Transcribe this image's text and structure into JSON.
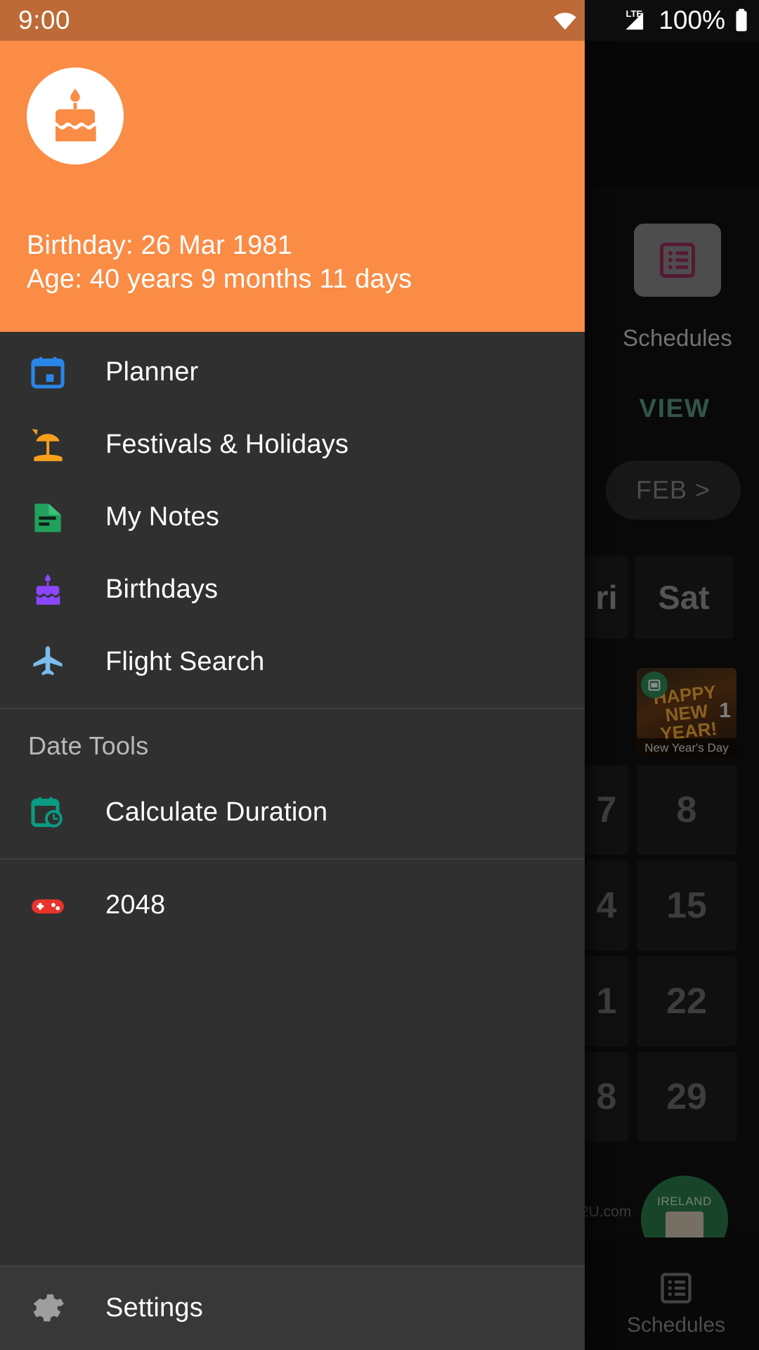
{
  "status_bar": {
    "time": "9:00",
    "wifi_icon": "wifi-icon",
    "network_label": "LTE",
    "battery_percent": "100%",
    "battery_icon": "battery-full-icon"
  },
  "drawer": {
    "header": {
      "avatar_icon": "birthday-cake-icon",
      "birthday_line": "Birthday: 26 Mar 1981",
      "age_line": "Age: 40 years 9 months 11 days",
      "background_color": "#fa8c46"
    },
    "primary_items": [
      {
        "label": "Planner",
        "icon": "calendar-icon",
        "color": "#2a86e8"
      },
      {
        "label": "Festivals & Holidays",
        "icon": "beach-umbrella-icon",
        "color": "#f9a01b"
      },
      {
        "label": "My Notes",
        "icon": "note-document-icon",
        "color": "#22a05c"
      },
      {
        "label": "Birthdays",
        "icon": "birthday-cake-icon",
        "color": "#8c46ff"
      },
      {
        "label": "Flight Search",
        "icon": "airplane-icon",
        "color": "#7bbdec"
      }
    ],
    "section_title": "Date Tools",
    "tool_items": [
      {
        "label": "Calculate Duration",
        "icon": "calendar-clock-icon",
        "color": "#0a9b82"
      }
    ],
    "game_items": [
      {
        "label": "2048",
        "icon": "gamepad-icon",
        "color": "#e8342a"
      }
    ],
    "footer_item": {
      "label": "Settings",
      "icon": "gear-icon",
      "color": "#9e9e9e"
    }
  },
  "background_app": {
    "schedules_tile_label": "Schedules",
    "schedules_tile_icon": "schedule-list-icon",
    "view_button": "VIEW",
    "month_pill": "FEB >",
    "weekday_headers": [
      "ri",
      "Sat"
    ],
    "week_rows": [
      {
        "left": "",
        "right": ""
      },
      {
        "left": "7",
        "right": "8"
      },
      {
        "left": "4",
        "right": "15"
      },
      {
        "left": "1",
        "right": "22"
      },
      {
        "left": "8",
        "right": "29"
      }
    ],
    "holiday": {
      "art_text": "HAPPY NEW YEAR!",
      "day_number": "1",
      "caption": "New Year's Day",
      "badge_icon": "event-badge-icon"
    },
    "ireland_badge": "IRELAND",
    "watermark": "2U.com",
    "bottom_bar_label": "Schedules",
    "bottom_bar_icon": "schedule-list-icon"
  }
}
